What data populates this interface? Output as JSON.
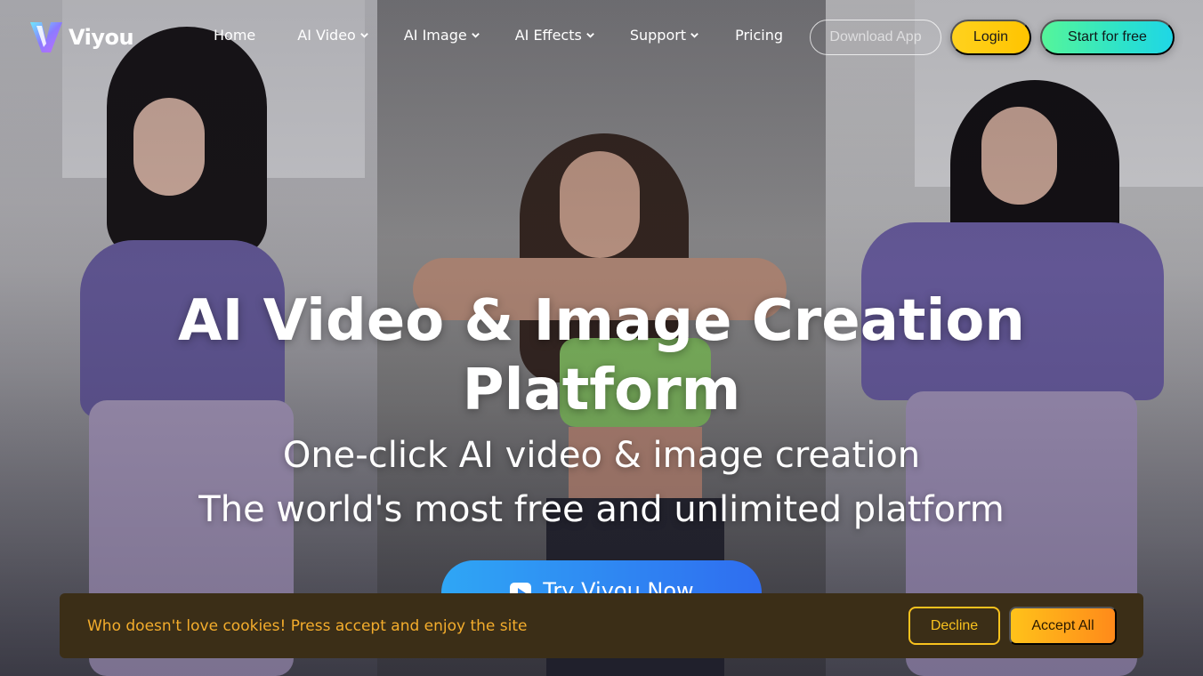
{
  "brand": {
    "name": "Viyou"
  },
  "nav": {
    "items": [
      {
        "label": "Home",
        "dropdown": false
      },
      {
        "label": "AI Video",
        "dropdown": true
      },
      {
        "label": "AI Image",
        "dropdown": true
      },
      {
        "label": "AI Effects",
        "dropdown": true
      },
      {
        "label": "Support",
        "dropdown": true
      },
      {
        "label": "Pricing",
        "dropdown": false
      }
    ],
    "download_label": "Download App",
    "login_label": "Login",
    "start_label": "Start for free"
  },
  "hero": {
    "title_line1": "AI Video & Image Creation",
    "title_line2": "Platform",
    "subtitle_line1": "One-click AI video & image creation",
    "subtitle_line2": "The world's most free and unlimited platform",
    "cta_label": "Try Viyou Now"
  },
  "cookie": {
    "message": "Who doesn't love cookies! Press accept and enjoy the site",
    "decline_label": "Decline",
    "accept_label": "Accept All"
  },
  "colors": {
    "accent_yellow": "#ffc400",
    "accent_green": "#2ee3c9",
    "cta_blue": "#2f6df0",
    "cookie_bg": "#3b2e17",
    "cookie_text": "#f4ad2c"
  }
}
